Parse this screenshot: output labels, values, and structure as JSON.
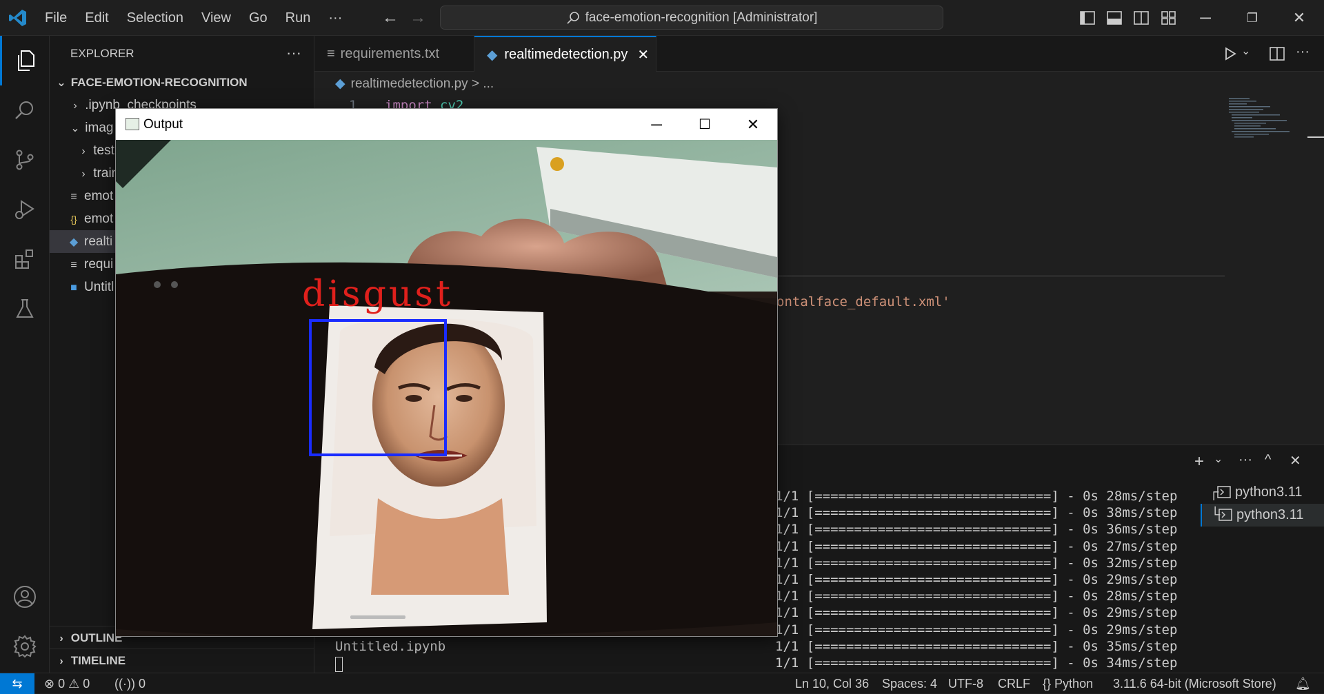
{
  "menu": [
    "File",
    "Edit",
    "Selection",
    "View",
    "Go",
    "Run",
    "···"
  ],
  "command_center": "face-emotion-recognition [Administrator]",
  "explorer": {
    "title": "EXPLORER",
    "more": "···",
    "root": "FACE-EMOTION-RECOGNITION",
    "items": [
      {
        "label": ".ipynb_checkpoints",
        "chev": ">",
        "indent": 1,
        "icon": ""
      },
      {
        "label": "imag",
        "chev": "v",
        "indent": 1,
        "icon": ""
      },
      {
        "label": "test",
        "chev": ">",
        "indent": 2,
        "icon": ""
      },
      {
        "label": "train",
        "chev": ">",
        "indent": 2,
        "icon": ""
      },
      {
        "label": "emot",
        "chev": "",
        "indent": 1,
        "icon": "≡"
      },
      {
        "label": "emot",
        "chev": "",
        "indent": 1,
        "icon": "{}"
      },
      {
        "label": "realti",
        "chev": "",
        "indent": 1,
        "icon": "py"
      },
      {
        "label": "requi",
        "chev": "",
        "indent": 1,
        "icon": "≡"
      },
      {
        "label": "Untitl",
        "chev": "",
        "indent": 1,
        "icon": "nb"
      }
    ],
    "outline": "OUTLINE",
    "timeline": "TIMELINE"
  },
  "tabs": [
    {
      "label": "requirements.txt",
      "icon": "≡"
    },
    {
      "label": "realtimedetection.py",
      "icon": "py"
    }
  ],
  "breadcrumb": {
    "file": "realtimedetection.py",
    "rest": "> ..."
  },
  "code": {
    "line1_num": "1",
    "line1_kw": "import",
    "line1_mod": "cv2",
    "fragment": "ontalface_default.xml'"
  },
  "terminal": {
    "lines": [
      "1/1 [==============================] - 0s 28ms/step",
      "1/1 [==============================] - 0s 38ms/step",
      "1/1 [==============================] - 0s 36ms/step",
      "1/1 [==============================] - 0s 27ms/step",
      "1/1 [==============================] - 0s 32ms/step",
      "1/1 [==============================] - 0s 29ms/step",
      "1/1 [==============================] - 0s 28ms/step",
      "1/1 [==============================] - 0s 29ms/step",
      "1/1 [==============================] - 0s 29ms/step",
      "1/1 [==============================] - 0s 35ms/step",
      "1/1 [==============================] - 0s 34ms/step"
    ],
    "left_text": "Untitled.ipynb",
    "instances": [
      "python3.11",
      "python3.11"
    ]
  },
  "statusbar": {
    "errors": "0",
    "warnings": "0",
    "ports": "0",
    "position": "Ln 10, Col 36",
    "spaces": "Spaces: 4",
    "encoding": "UTF-8",
    "eol": "CRLF",
    "language": "Python",
    "interpreter": "3.11.6 64-bit (Microsoft Store)"
  },
  "output_window": {
    "title": "Output",
    "emotion_label": "disgust"
  },
  "colors": {
    "accent": "#0078d4",
    "emotion_text": "#e0201c",
    "face_box": "#1a2cff"
  }
}
